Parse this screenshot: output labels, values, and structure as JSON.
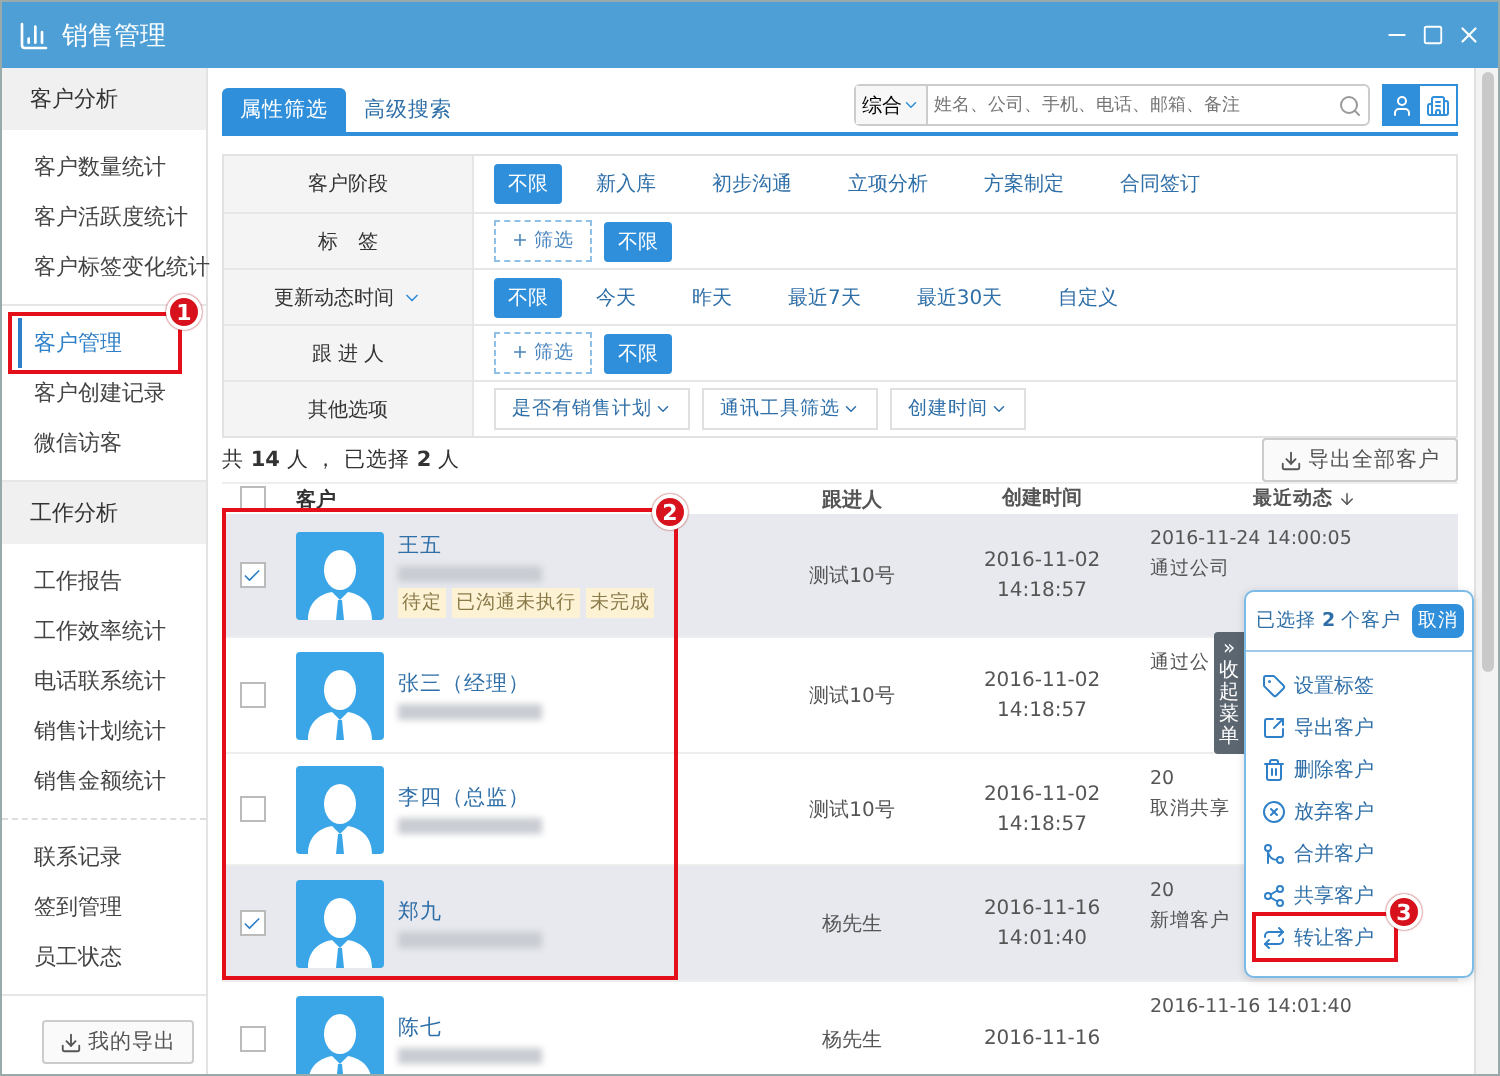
{
  "window": {
    "title": "销售管理"
  },
  "sidebar": {
    "sections": [
      {
        "header": "客户分析",
        "items": [
          {
            "label": "客户数量统计",
            "selected": false
          },
          {
            "label": "客户活跃度统计",
            "selected": false
          },
          {
            "label": "客户标签变化统计",
            "selected": false
          }
        ]
      },
      {
        "items": [
          {
            "label": "客户管理",
            "selected": true
          },
          {
            "label": "客户创建记录",
            "selected": false
          },
          {
            "label": "微信访客",
            "selected": false
          }
        ]
      },
      {
        "header": "工作分析",
        "items": [
          {
            "label": "工作报告",
            "selected": false
          },
          {
            "label": "工作效率统计",
            "selected": false
          },
          {
            "label": "电话联系统计",
            "selected": false
          },
          {
            "label": "销售计划统计",
            "selected": false
          },
          {
            "label": "销售金额统计",
            "selected": false
          }
        ]
      },
      {
        "items": [
          {
            "label": "联系记录",
            "selected": false
          },
          {
            "label": "签到管理",
            "selected": false
          },
          {
            "label": "员工状态",
            "selected": false
          }
        ]
      }
    ],
    "export_button": "我的导出"
  },
  "tabs": [
    {
      "label": "属性筛选",
      "selected": true
    },
    {
      "label": "高级搜索",
      "selected": false
    }
  ],
  "search": {
    "scope": "综合",
    "placeholder": "姓名、公司、手机、电话、邮箱、备注"
  },
  "view_toggle": [
    {
      "kind": "person",
      "selected": true
    },
    {
      "kind": "company",
      "selected": false
    }
  ],
  "filters": [
    {
      "label": "客户阶段",
      "has_menu": false,
      "options": [
        {
          "kind": "option",
          "label": "不限",
          "selected": true
        },
        {
          "kind": "option",
          "label": "新入库",
          "selected": false
        },
        {
          "kind": "option",
          "label": "初步沟通",
          "selected": false
        },
        {
          "kind": "option",
          "label": "立项分析",
          "selected": false
        },
        {
          "kind": "option",
          "label": "方案制定",
          "selected": false
        },
        {
          "kind": "option",
          "label": "合同签订",
          "selected": false
        }
      ]
    },
    {
      "label": "标　签",
      "has_menu": false,
      "options": [
        {
          "kind": "add",
          "label": "+ 筛选"
        },
        {
          "kind": "option",
          "label": "不限",
          "selected": true
        }
      ]
    },
    {
      "label": "更新动态时间",
      "has_menu": true,
      "options": [
        {
          "kind": "option",
          "label": "不限",
          "selected": true
        },
        {
          "kind": "option",
          "label": "今天",
          "selected": false
        },
        {
          "kind": "option",
          "label": "昨天",
          "selected": false
        },
        {
          "kind": "option",
          "label": "最近7天",
          "selected": false
        },
        {
          "kind": "option",
          "label": "最近30天",
          "selected": false
        },
        {
          "kind": "option",
          "label": "自定义",
          "selected": false
        }
      ]
    },
    {
      "label": "跟 进 人",
      "has_menu": false,
      "options": [
        {
          "kind": "add",
          "label": "+ 筛选"
        },
        {
          "kind": "option",
          "label": "不限",
          "selected": true
        }
      ]
    },
    {
      "label": "其他选项",
      "has_menu": false,
      "options": [
        {
          "kind": "dropdown",
          "label": "是否有销售计划"
        },
        {
          "kind": "dropdown",
          "label": "通讯工具筛选"
        },
        {
          "kind": "dropdown",
          "label": "创建时间"
        }
      ]
    }
  ],
  "summary": "共 **14** 人 ， 已选择 **2** 人",
  "export_all": "导出全部客户",
  "table": {
    "select_all": {
      "checked": false
    },
    "columns": [
      {
        "label": "客户",
        "sorted": false
      },
      {
        "label": "跟进人",
        "sorted": false
      },
      {
        "label": "创建时间",
        "sorted": false
      },
      {
        "label": "最近动态",
        "sorted": true
      }
    ],
    "rows": [
      {
        "name": "王五",
        "selected": true,
        "tags": [
          "待定",
          "已沟通未执行",
          "未完成"
        ],
        "follower": "测试10号",
        "created_date": "2016-11-02",
        "created_time": "14:18:57",
        "activity_time": "2016-11-24 14:00:05",
        "activity": "通过公司"
      },
      {
        "name": "张三（经理）",
        "selected": false,
        "tags": [],
        "follower": "测试10号",
        "created_date": "2016-11-02",
        "created_time": "14:18:57",
        "activity": "通过公"
      },
      {
        "name": "李四（总监）",
        "selected": false,
        "tags": [],
        "follower": "测试10号",
        "created_date": "2016-11-02",
        "created_time": "14:18:57",
        "activity_time": "20",
        "activity": "取消共享"
      },
      {
        "name": "郑九",
        "selected": true,
        "tags": [],
        "follower": "杨先生",
        "created_date": "2016-11-16",
        "created_time": "14:01:40",
        "activity_time": "20",
        "activity": "新增客户"
      },
      {
        "name": "陈七",
        "selected": false,
        "tags": [],
        "follower": "杨先生",
        "created_date": "2016-11-16",
        "activity_time": "2016-11-16 14:01:40"
      }
    ]
  },
  "batch_panel": {
    "header": "已选择 **2** 个客户",
    "cancel": "取消",
    "actions": [
      {
        "kind": "tag",
        "label": "设置标签"
      },
      {
        "kind": "export",
        "label": "导出客户"
      },
      {
        "kind": "delete",
        "label": "删除客户"
      },
      {
        "kind": "abandon",
        "label": "放弃客户"
      },
      {
        "kind": "merge",
        "label": "合并客户"
      },
      {
        "kind": "share",
        "label": "共享客户"
      },
      {
        "kind": "transfer",
        "label": "转让客户"
      }
    ]
  },
  "collapse_tab": {
    "arrow": "»",
    "label": "收起菜单"
  },
  "callouts": [
    {
      "number": "1"
    },
    {
      "number": "2"
    },
    {
      "number": "3"
    }
  ]
}
